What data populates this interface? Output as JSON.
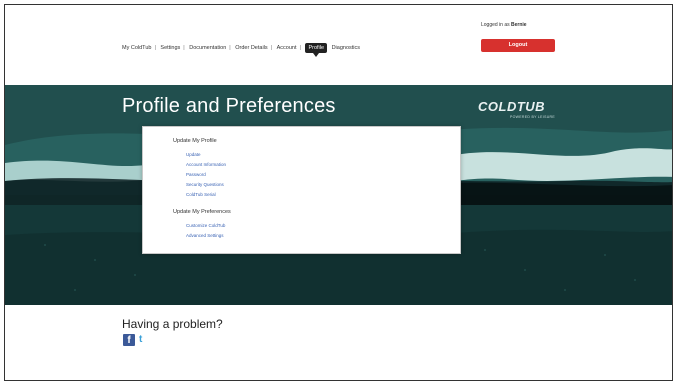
{
  "nav": {
    "items": [
      "My ColdTub",
      "Settings",
      "Documentation",
      "Order Details",
      "Account"
    ],
    "active": "Profile",
    "last": "Diagnostics"
  },
  "header": {
    "logged_in_prefix": "Logged in as",
    "logged_in_name": "Bernie",
    "logout_label": "Logout"
  },
  "banner": {
    "title": "Profile and Preferences",
    "brand": "COLDTUB",
    "brand_tagline": "POWERED BY LEISURE"
  },
  "panel": {
    "profile_heading": "Update My Profile",
    "profile_links": [
      "Update",
      "Account Information",
      "Password",
      "Security Questions",
      "ColdTub Serial"
    ],
    "prefs_heading": "Update My Preferences",
    "prefs_links": [
      "Customize ColdTub",
      "Advanced Settings"
    ]
  },
  "footer": {
    "problem_text": "Having a problem?",
    "facebook_glyph": "f",
    "twitter_glyph": "t"
  },
  "colors": {
    "logout_button": "#d7312e",
    "link": "#3a63b4",
    "banner": "#1f4f4e"
  }
}
